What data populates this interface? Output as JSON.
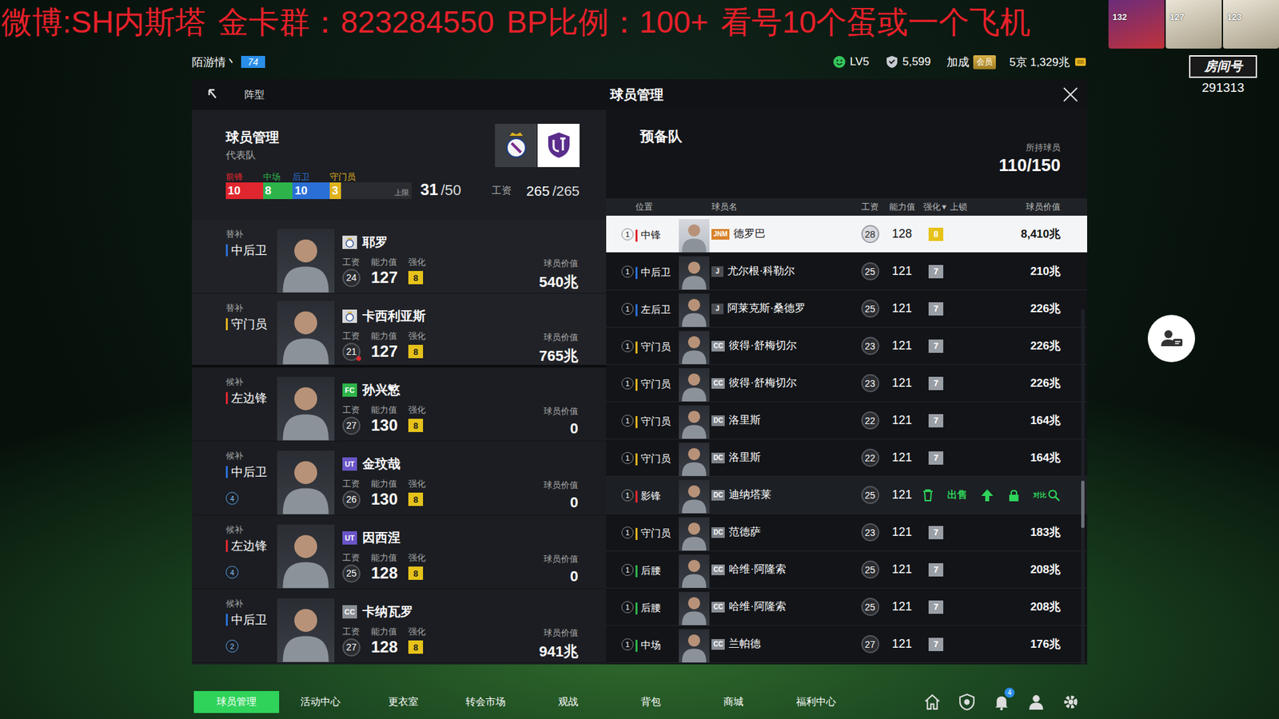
{
  "banner": {
    "text": "微博:SH内斯塔 金卡群：823284550 BP比例：100+ 看号10个蛋或一个飞机"
  },
  "corner_cards": [
    {
      "rating": "132"
    },
    {
      "rating": "127"
    },
    {
      "rating": "123"
    }
  ],
  "room": {
    "label": "房间号",
    "number": "291313"
  },
  "user": {
    "name": "陌游情丶",
    "level": "74"
  },
  "stats": {
    "lv": "LV5",
    "points": "5,599",
    "bonus": "加成",
    "vip": "会员",
    "money": "5京 1,329兆"
  },
  "panel": {
    "back_tab": "阵型",
    "title": "球员管理"
  },
  "team": {
    "title": "球员管理",
    "subtitle": "代表队",
    "lines": [
      {
        "label": "前锋",
        "count": "10",
        "level": 0.2,
        "color": "#e0262f"
      },
      {
        "label": "中场",
        "count": "8",
        "level": 0.16,
        "color": "#2db34a"
      },
      {
        "label": "后卫",
        "count": "10",
        "level": 0.2,
        "color": "#2a6fd6"
      },
      {
        "label": "守门员",
        "count": "3",
        "level": 0.06,
        "color": "#e0b21e"
      }
    ],
    "cap_label": "上限",
    "used": "31",
    "cap": "/50",
    "wage_label": "工资",
    "wage_used": "265",
    "wage_cap": "/265"
  },
  "card_labels": {
    "wage": "工资",
    "rating": "能力值",
    "enhance": "强化",
    "value": "球员价值"
  },
  "lineup": [
    {
      "kind": "bench",
      "role": "替补",
      "position": "中后卫",
      "line_color": "#2a6fd6",
      "badge": {
        "kind": "crest",
        "text": "",
        "color": "#d8d8d8"
      },
      "name": "耶罗",
      "wage": "24",
      "alert": false,
      "rating": "127",
      "enhance": "8",
      "value": "540兆",
      "number": ""
    },
    {
      "kind": "bench",
      "role": "替补",
      "position": "守门员",
      "line_color": "#e0b21e",
      "badge": {
        "kind": "crest",
        "text": "",
        "color": "#d8d8d8"
      },
      "name": "卡西利亚斯",
      "wage": "21",
      "alert": true,
      "rating": "127",
      "enhance": "8",
      "value": "765兆",
      "number": ""
    },
    {
      "kind": "reserve",
      "role": "候补",
      "position": "左边锋",
      "line_color": "#e0262f",
      "badge": {
        "kind": "text",
        "text": "FC",
        "color": "#2db34a"
      },
      "name": "孙兴慜",
      "wage": "27",
      "alert": false,
      "rating": "130",
      "enhance": "8",
      "value": "0",
      "number": ""
    },
    {
      "kind": "reserve",
      "role": "候补",
      "position": "中后卫",
      "line_color": "#2a6fd6",
      "badge": {
        "kind": "text",
        "text": "UT",
        "color": "#6a55c8"
      },
      "name": "金玟哉",
      "wage": "26",
      "alert": false,
      "rating": "130",
      "enhance": "8",
      "value": "0",
      "number": "4"
    },
    {
      "kind": "reserve",
      "role": "候补",
      "position": "左边锋",
      "line_color": "#e0262f",
      "badge": {
        "kind": "text",
        "text": "UT",
        "color": "#6a55c8"
      },
      "name": "因西涅",
      "wage": "25",
      "alert": false,
      "rating": "128",
      "enhance": "8",
      "value": "0",
      "number": "4"
    },
    {
      "kind": "reserve",
      "role": "候补",
      "position": "中后卫",
      "line_color": "#2a6fd6",
      "badge": {
        "kind": "text",
        "text": "CC",
        "color": "#8a8f96"
      },
      "name": "卡纳瓦罗",
      "wage": "27",
      "alert": false,
      "rating": "128",
      "enhance": "8",
      "value": "941兆",
      "number": "2"
    }
  ],
  "reserve": {
    "title": "预备队",
    "owned_label": "所持球员",
    "owned": "110/150",
    "columns": [
      "位置",
      "球员名",
      "工资",
      "能力值",
      "强化",
      "上锁",
      "球员价值"
    ],
    "sort_icon": "▾",
    "actions": {
      "sell": "出售",
      "compare": "对比"
    },
    "rows": [
      {
        "kind": "normal",
        "selected": true,
        "index": "1",
        "position": "中锋",
        "line_color": "#e0262f",
        "badge": "JNM",
        "badge_color": "#d9822b",
        "name": "德罗巴",
        "wage": "28",
        "rating": "128",
        "enhance": "8",
        "enhance_color": "#e6c21a",
        "value": "8,410兆"
      },
      {
        "kind": "normal",
        "selected": false,
        "index": "1",
        "position": "中后卫",
        "line_color": "#2a6fd6",
        "badge": "J",
        "badge_color": "#4a4d52",
        "name": "尤尔根·科勒尔",
        "wage": "25",
        "rating": "121",
        "enhance": "7",
        "enhance_color": "#9a9ea5",
        "value": "210兆"
      },
      {
        "kind": "normal",
        "selected": false,
        "index": "1",
        "position": "左后卫",
        "line_color": "#2a6fd6",
        "badge": "J",
        "badge_color": "#4a4d52",
        "name": "阿莱克斯·桑德罗",
        "wage": "25",
        "rating": "121",
        "enhance": "7",
        "enhance_color": "#9a9ea5",
        "value": "226兆"
      },
      {
        "kind": "normal",
        "selected": false,
        "index": "1",
        "position": "守门员",
        "line_color": "#e0b21e",
        "badge": "CC",
        "badge_color": "#8a8f96",
        "name": "彼得·舒梅切尔",
        "wage": "23",
        "rating": "121",
        "enhance": "7",
        "enhance_color": "#9a9ea5",
        "value": "226兆"
      },
      {
        "kind": "normal",
        "selected": false,
        "index": "1",
        "position": "守门员",
        "line_color": "#e0b21e",
        "badge": "CC",
        "badge_color": "#8a8f96",
        "name": "彼得·舒梅切尔",
        "wage": "23",
        "rating": "121",
        "enhance": "7",
        "enhance_color": "#9a9ea5",
        "value": "226兆"
      },
      {
        "kind": "normal",
        "selected": false,
        "index": "1",
        "position": "守门员",
        "line_color": "#e0b21e",
        "badge": "DC",
        "badge_color": "#7d8289",
        "name": "洛里斯",
        "wage": "22",
        "rating": "121",
        "enhance": "7",
        "enhance_color": "#9a9ea5",
        "value": "164兆"
      },
      {
        "kind": "normal",
        "selected": false,
        "index": "1",
        "position": "守门员",
        "line_color": "#e0b21e",
        "badge": "DC",
        "badge_color": "#7d8289",
        "name": "洛里斯",
        "wage": "22",
        "rating": "121",
        "enhance": "7",
        "enhance_color": "#9a9ea5",
        "value": "164兆"
      },
      {
        "kind": "actions",
        "selected": false,
        "index": "1",
        "position": "影锋",
        "line_color": "#e0262f",
        "badge": "DC",
        "badge_color": "#7d8289",
        "name": "迪纳塔莱",
        "wage": "25",
        "rating": "121"
      },
      {
        "kind": "normal",
        "selected": false,
        "index": "1",
        "position": "守门员",
        "line_color": "#e0b21e",
        "badge": "DC",
        "badge_color": "#7d8289",
        "name": "范德萨",
        "wage": "23",
        "rating": "121",
        "enhance": "7",
        "enhance_color": "#9a9ea5",
        "value": "183兆"
      },
      {
        "kind": "normal",
        "selected": false,
        "index": "1",
        "position": "后腰",
        "line_color": "#2db34a",
        "badge": "CC",
        "badge_color": "#8a8f96",
        "name": "哈维·阿隆索",
        "wage": "25",
        "rating": "121",
        "enhance": "7",
        "enhance_color": "#9a9ea5",
        "value": "208兆"
      },
      {
        "kind": "normal",
        "selected": false,
        "index": "1",
        "position": "后腰",
        "line_color": "#2db34a",
        "badge": "CC",
        "badge_color": "#8a8f96",
        "name": "哈维·阿隆索",
        "wage": "25",
        "rating": "121",
        "enhance": "7",
        "enhance_color": "#9a9ea5",
        "value": "208兆"
      },
      {
        "kind": "normal",
        "selected": false,
        "index": "1",
        "position": "中场",
        "line_color": "#2db34a",
        "badge": "CC",
        "badge_color": "#8a8f96",
        "name": "兰帕德",
        "wage": "27",
        "rating": "121",
        "enhance": "7",
        "enhance_color": "#9a9ea5",
        "value": "176兆"
      }
    ]
  },
  "nav": {
    "tabs": [
      {
        "label": "球员管理",
        "selected": true
      },
      {
        "label": "活动中心",
        "selected": false
      },
      {
        "label": "更衣室",
        "selected": false
      },
      {
        "label": "转会市场",
        "selected": false
      },
      {
        "label": "观战",
        "selected": false
      },
      {
        "label": "背包",
        "selected": false
      },
      {
        "label": "商城",
        "selected": false
      },
      {
        "label": "福利中心",
        "selected": false
      }
    ],
    "bell_count": "4"
  }
}
